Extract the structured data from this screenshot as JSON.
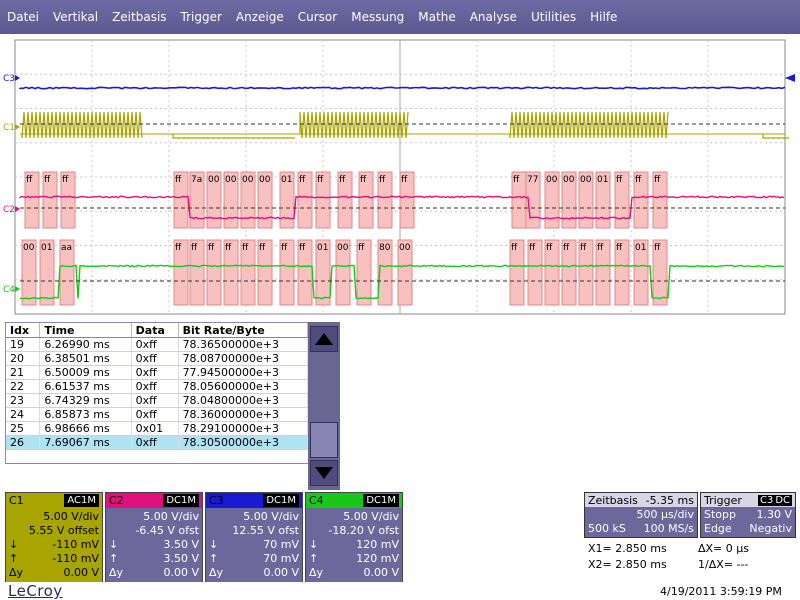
{
  "menu": [
    "Datei",
    "Vertikal",
    "Zeitbasis",
    "Trigger",
    "Anzeige",
    "Cursor",
    "Messung",
    "Mathe",
    "Analyse",
    "Utilities",
    "Hilfe"
  ],
  "traces": {
    "colors": {
      "C1": "#a8a400",
      "C2": "#e0107a",
      "C3": "#1a1ad0",
      "C4": "#18c818"
    },
    "labels": [
      "C3",
      "C1",
      "C2",
      "C4"
    ],
    "c2_bytes": [
      "ff",
      "ff",
      "ff",
      "ff",
      "7a",
      "00",
      "00",
      "00",
      "00",
      "01",
      "ff",
      "ff",
      "ff",
      "ff",
      "ff",
      "ff",
      "ff",
      "77",
      "00",
      "00",
      "00",
      "01",
      "ff",
      "ff",
      "ff"
    ],
    "c4_bytes": [
      "00",
      "01",
      "aa",
      "ff",
      "ff",
      "ff",
      "ff",
      "ff",
      "ff",
      "ff",
      "ff",
      "01",
      "00",
      "ff",
      "80",
      "00",
      "ff",
      "ff",
      "ff",
      "ff",
      "ff",
      "ff",
      "ff",
      "01",
      "ff"
    ]
  },
  "table": {
    "headers": [
      "Idx",
      "Time",
      "Data",
      "Bit Rate/Byte"
    ],
    "rows": [
      [
        "19",
        "6.26990 ms",
        "0xff",
        "78.36500000e+3"
      ],
      [
        "20",
        "6.38501 ms",
        "0xff",
        "78.08700000e+3"
      ],
      [
        "21",
        "6.50009 ms",
        "0xff",
        "77.94500000e+3"
      ],
      [
        "22",
        "6.61537 ms",
        "0xff",
        "78.05600000e+3"
      ],
      [
        "23",
        "6.74329 ms",
        "0xff",
        "78.04800000e+3"
      ],
      [
        "24",
        "6.85873 ms",
        "0xff",
        "78.36000000e+3"
      ],
      [
        "25",
        "6.98666 ms",
        "0x01",
        "78.29100000e+3"
      ],
      [
        "26",
        "7.69067 ms",
        "0xff",
        "78.30500000e+3"
      ]
    ],
    "selected_index": 7
  },
  "channels": [
    {
      "name": "C1",
      "coupling": "AC1M",
      "color": "#a8a400",
      "scale": "5.00 V/div",
      "offset": "5.55 V offset",
      "down": "-110 mV",
      "up": "-110 mV",
      "dy": "0.00 V",
      "down_sym": "↓",
      "up_sym": "↑",
      "dy_sym": "Δy"
    },
    {
      "name": "C2",
      "coupling": "DC1M",
      "color": "#e0107a",
      "scale": "5.00 V/div",
      "offset": "-6.45 V ofst",
      "down": "3.50 V",
      "up": "3.50 V",
      "dy": "0.00 V",
      "down_sym": "↓",
      "up_sym": "↑",
      "dy_sym": "Δy"
    },
    {
      "name": "C3",
      "coupling": "DC1M",
      "color": "#1a1ad0",
      "scale": "5.00 V/div",
      "offset": "12.55 V ofst",
      "down": "70 mV",
      "up": "70 mV",
      "dy": "0.00 V",
      "down_sym": "↓",
      "up_sym": "↑",
      "dy_sym": "Δy"
    },
    {
      "name": "C4",
      "coupling": "DC1M",
      "color": "#18c818",
      "scale": "5.00 V/div",
      "offset": "-18.20 V ofst",
      "down": "120 mV",
      "up": "120 mV",
      "dy": "0.00 V",
      "down_sym": "↓",
      "up_sym": "↑",
      "dy_sym": "Δy"
    }
  ],
  "timebase": {
    "title": "Zeitbasis",
    "delay": "-5.35 ms",
    "per_div": "500 µs/div",
    "samples": "500 kS",
    "rate": "100 MS/s"
  },
  "trigger": {
    "title": "Trigger",
    "source": "C3",
    "coupling": "DC",
    "mode": "Stopp",
    "level": "1.30 V",
    "type": "Edge",
    "slope": "Negativ"
  },
  "cursor": {
    "x1": "X1= 2.850 ms",
    "dx": "ΔX= 0 µs",
    "x2": "X2= 2.850 ms",
    "inv_dx": "1/ΔX= ---"
  },
  "brand": "LeCroy",
  "datetime": "4/19/2011 3:59:19 PM"
}
